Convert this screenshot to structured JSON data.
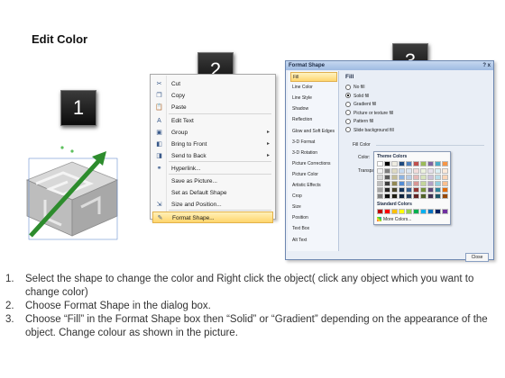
{
  "slide_title": "Edit Color",
  "badges": {
    "one": "1",
    "two": "2",
    "three": "3"
  },
  "context_menu": {
    "items": [
      {
        "label": "Cut",
        "icon": "scissors-icon",
        "arrow": false
      },
      {
        "label": "Copy",
        "icon": "copy-icon",
        "arrow": false
      },
      {
        "label": "Paste",
        "icon": "clipboard-icon",
        "arrow": false
      },
      {
        "label": "Edit Text",
        "icon": "edit-text-icon",
        "arrow": false
      },
      {
        "label": "Group",
        "icon": "group-icon",
        "arrow": true
      },
      {
        "label": "Bring to Front",
        "icon": "bring-front-icon",
        "arrow": true
      },
      {
        "label": "Send to Back",
        "icon": "send-back-icon",
        "arrow": true
      },
      {
        "label": "Hyperlink...",
        "icon": "hyperlink-icon",
        "arrow": false
      },
      {
        "label": "Save as Picture...",
        "icon": "",
        "arrow": false
      },
      {
        "label": "Set as Default Shape",
        "icon": "",
        "arrow": false
      },
      {
        "label": "Size and Position...",
        "icon": "size-position-icon",
        "arrow": false
      },
      {
        "label": "Format Shape...",
        "icon": "format-shape-icon",
        "arrow": false
      }
    ]
  },
  "format_dialog": {
    "title": "Format Shape",
    "close_glyph": "?  x",
    "categories": [
      "Fill",
      "Line Color",
      "Line Style",
      "Shadow",
      "Reflection",
      "Glow and Soft Edges",
      "3-D Format",
      "3-D Rotation",
      "Picture Corrections",
      "Picture Color",
      "Artistic Effects",
      "Crop",
      "Size",
      "Position",
      "Text Box",
      "Alt Text"
    ],
    "selected_category": "Fill",
    "fill_heading": "Fill",
    "fill_options": [
      {
        "label": "No fill",
        "selected": false
      },
      {
        "label": "Solid fill",
        "selected": true
      },
      {
        "label": "Gradient fill",
        "selected": false
      },
      {
        "label": "Picture or texture fill",
        "selected": false
      },
      {
        "label": "Pattern fill",
        "selected": false
      },
      {
        "label": "Slide background fill",
        "selected": false
      }
    ],
    "fill_color_heading": "Fill Color",
    "color_label": "Color:",
    "transparency_label": "Transpa",
    "close_button": "Close"
  },
  "color_popup": {
    "theme_heading": "Theme Colors",
    "standard_heading": "Standard Colors",
    "more_colors": "More Colors...",
    "theme_top_row": [
      "#ffffff",
      "#000000",
      "#eeece1",
      "#1f497d",
      "#4f81bd",
      "#c0504d",
      "#9bbb59",
      "#8064a2",
      "#4bacc6",
      "#f79646"
    ],
    "theme_shades": [
      [
        "#f2f2f2",
        "#7f7f7f",
        "#ddd9c3",
        "#c6d9f0",
        "#dbe5f1",
        "#f2dcdb",
        "#ebf1dd",
        "#e5e0ec",
        "#dbeef3",
        "#fdeada"
      ],
      [
        "#d8d8d8",
        "#595959",
        "#c4bd97",
        "#8db3e2",
        "#b8cce4",
        "#e5b9b7",
        "#d7e3bc",
        "#ccc1d9",
        "#b7dde8",
        "#fbd5b5"
      ],
      [
        "#bfbfbf",
        "#3f3f3f",
        "#938953",
        "#548dd4",
        "#95b3d7",
        "#d99694",
        "#c3d69b",
        "#b2a2c7",
        "#92cddc",
        "#fac08f"
      ],
      [
        "#a5a5a5",
        "#262626",
        "#494429",
        "#17365d",
        "#366092",
        "#953734",
        "#76923c",
        "#5f497a",
        "#31859b",
        "#e36c09"
      ],
      [
        "#7f7f7f",
        "#0c0c0c",
        "#1d1b10",
        "#0f243e",
        "#244061",
        "#632423",
        "#4f6128",
        "#3f3151",
        "#205867",
        "#974806"
      ]
    ],
    "standard_colors": [
      "#c00000",
      "#ff0000",
      "#ffc000",
      "#ffff00",
      "#92d050",
      "#00b050",
      "#00b0f0",
      "#0070c0",
      "#002060",
      "#7030a0"
    ]
  },
  "instructions": [
    {
      "num": "1.",
      "text": "Select the shape to change the color and Right click the object( click any object which you want to change color)"
    },
    {
      "num": "2.",
      "text": "Choose Format Shape in the dialog box."
    },
    {
      "num": "3.",
      "text": "Choose “Fill” in the Format Shape box then “Solid” or “Gradient” depending on the appearance of the object. Change colour as shown in the picture."
    }
  ]
}
